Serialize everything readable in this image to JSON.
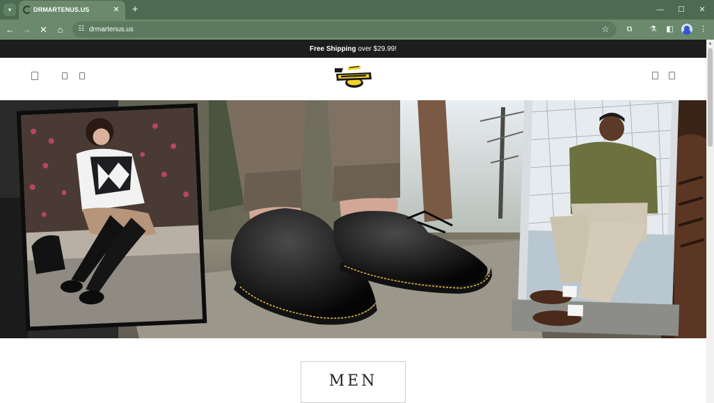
{
  "browser": {
    "tab_title": "DRMARTENUS.US",
    "url": "drmartenus.us",
    "new_tab": "+",
    "tab_close": "✕"
  },
  "page": {
    "announcement": {
      "bold": "Free Shipping",
      "rest": " over $29.99!"
    },
    "logo_text": "Dr. Martens AirWair",
    "category_button": "MEN"
  },
  "colors": {
    "browser_frame": "#4d6b52",
    "toolbar": "#6b8a6d",
    "announcement_bar": "#1d1d1d",
    "logo_yellow": "#f3d32a"
  },
  "icons": [
    "back-icon",
    "forward-icon",
    "stop-icon",
    "home-icon",
    "site-settings-icon",
    "bookmark-star-icon",
    "extensions-icon",
    "labs-icon",
    "sidebar-icon",
    "profile-icon",
    "more-menu-icon",
    "minimize-icon",
    "maximize-icon",
    "close-window-icon"
  ]
}
